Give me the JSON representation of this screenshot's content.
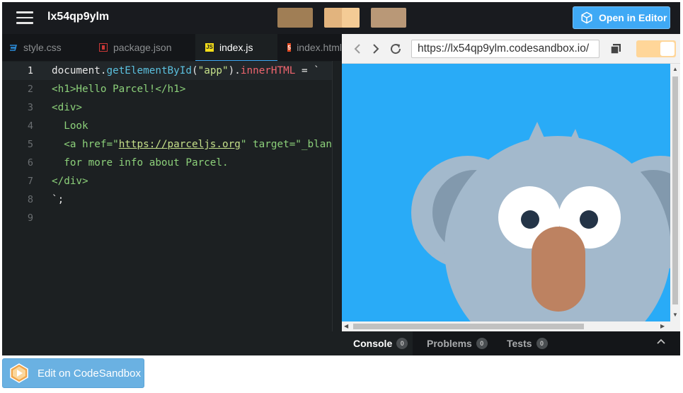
{
  "header": {
    "title": "lx54qp9ylm",
    "menu_icon": "hamburger-menu-icon",
    "swatches": [
      "#a07e55",
      "#e2b47e",
      "#b99877"
    ],
    "open_editor_label": "Open in Editor",
    "open_editor_icon": "cube-icon"
  },
  "tabs": [
    {
      "label": "style.css",
      "icon": "css-file-icon",
      "color": "#2b8bd8"
    },
    {
      "label": "package.json",
      "icon": "npm-file-icon",
      "color": "#cb3837"
    },
    {
      "label": "index.js",
      "icon": "js-file-icon",
      "color": "#f5de19",
      "active": true
    },
    {
      "label": "index.html",
      "icon": "html-file-icon",
      "color": "#e44d26"
    }
  ],
  "code": {
    "line_numbers": [
      "1",
      "2",
      "3",
      "4",
      "5",
      "6",
      "7",
      "8",
      "9"
    ],
    "l1": {
      "obj": "document",
      "dot1": ".",
      "method": "getElementById",
      "open": "(",
      "arg": "\"app\"",
      "close": ")",
      "dot2": ".",
      "prop": "innerHTML",
      "rest": " = `"
    },
    "l2": "<h1>Hello Parcel!</h1>",
    "l3": "<div>",
    "l4": "  Look",
    "l5": {
      "pre": "  <a href=\"",
      "link": "https://parceljs.org",
      "post": "\" target=\"_blank"
    },
    "l6": "  for more info about Parcel.",
    "l7": "</div>",
    "l8": "`;"
  },
  "browser": {
    "url": "https://lx54qp9ylm.codesandbox.io/",
    "back_icon": "chevron-left-icon",
    "forward_icon": "chevron-right-icon",
    "refresh_icon": "refresh-icon",
    "copy_icon": "copy-icon",
    "toggle_color": "#ffd699"
  },
  "console": {
    "tabs": [
      {
        "label": "Console",
        "count": "0",
        "active": true
      },
      {
        "label": "Problems",
        "count": "0"
      },
      {
        "label": "Tests",
        "count": "0"
      }
    ],
    "collapse_icon": "chevron-up-icon"
  },
  "footer": {
    "button_label": "Edit on CodeSandbox",
    "button_icon": "codesandbox-logo-icon"
  }
}
